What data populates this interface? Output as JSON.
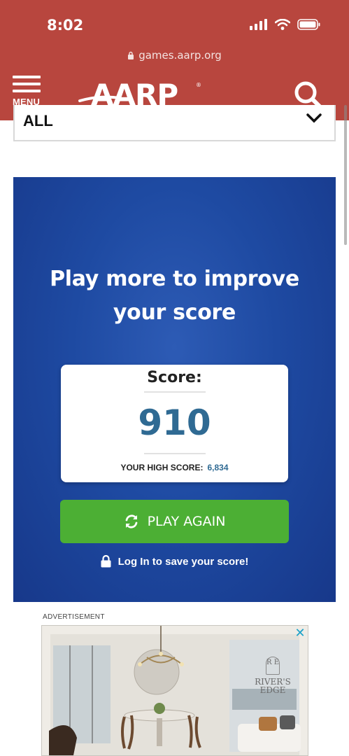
{
  "status": {
    "time": "8:02"
  },
  "browser": {
    "url": "games.aarp.org"
  },
  "header": {
    "menu_label": "MENU",
    "logo_text": "AARP"
  },
  "filter": {
    "value": "ALL"
  },
  "game": {
    "headline_line1": "Play more to improve",
    "headline_line2": "your score",
    "score_label": "Score:",
    "score_value": "910",
    "high_score_label": "YOUR HIGH SCORE:",
    "high_score_value": "6,834",
    "play_again_label": "PLAY AGAIN",
    "login_label": "Log In to save your score!"
  },
  "ad": {
    "label": "ADVERTISEMENT",
    "brand_monogram": "R E",
    "brand_name_line1": "RIVER'S",
    "brand_name_line2": "EDGE",
    "close_icon": "x-icon"
  },
  "colors": {
    "header_bg": "#b8463e",
    "panel_blue": "#1e4aa2",
    "score_blue": "#2f6a93",
    "play_green": "#4caf34"
  }
}
